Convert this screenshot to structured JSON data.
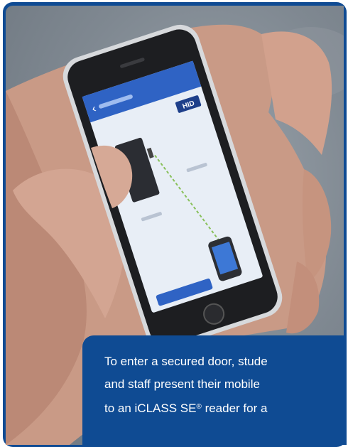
{
  "photo": {
    "subject": "hand holding smartphone showing mobile access app"
  },
  "phone_screen": {
    "brand_badge": "HID",
    "back_label": "‹",
    "screen_color": "#e8eef6",
    "header_color": "#2f63c4"
  },
  "caption": {
    "line1": "To enter a secured door, stude",
    "line2": "and staff present their mobile",
    "line3_before": "to an iCLASS SE",
    "line3_reg": "®",
    "line3_after": " reader for a"
  },
  "colors": {
    "frame": "#0f4b93",
    "caption_bg": "#0f4b93",
    "caption_text": "#ffffff"
  }
}
